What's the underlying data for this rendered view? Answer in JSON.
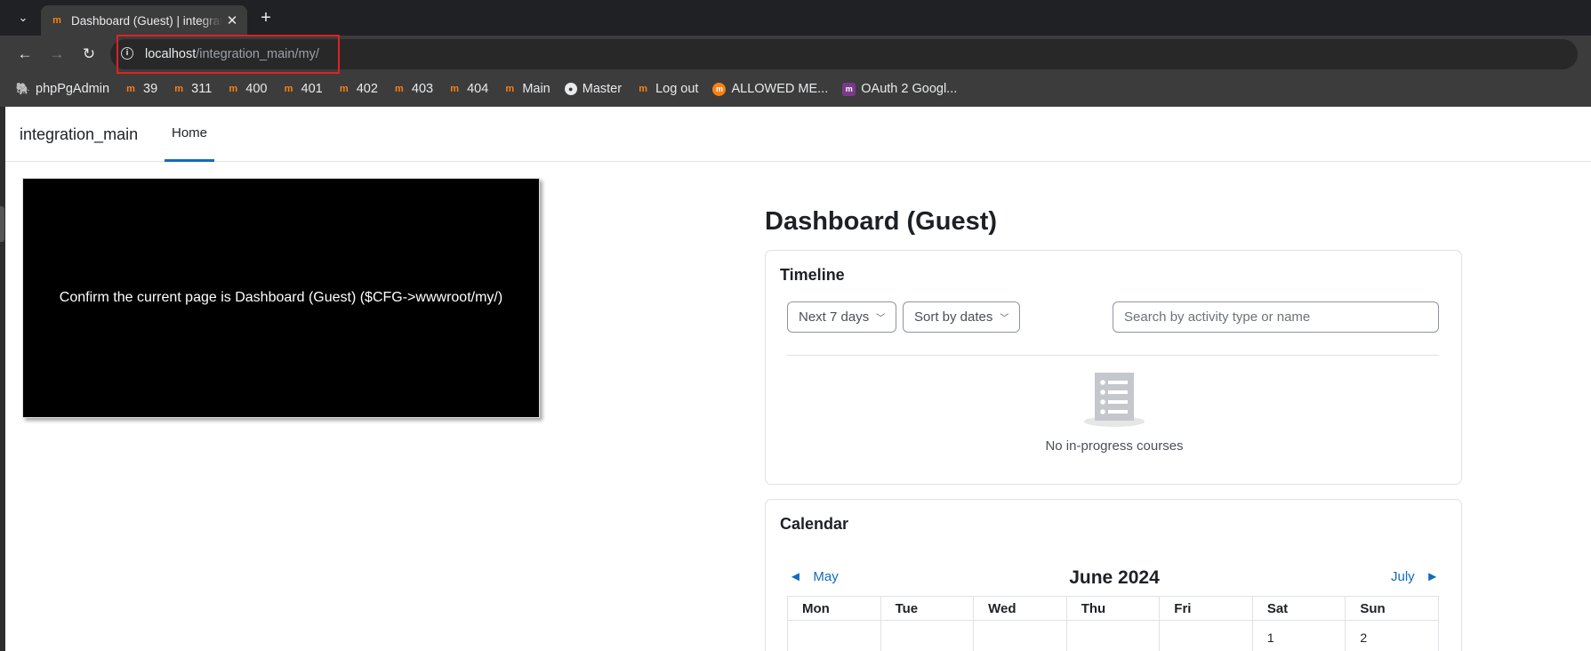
{
  "browser": {
    "tab_title": "Dashboard (Guest) | integration_main",
    "url_host": "localhost",
    "url_path": "/integration_main/my/",
    "bookmarks": [
      {
        "label": "phpPgAdmin",
        "icon": "elephant-icon"
      },
      {
        "label": "39",
        "icon": "moodle-icon"
      },
      {
        "label": "311",
        "icon": "moodle-icon"
      },
      {
        "label": "400",
        "icon": "moodle-icon"
      },
      {
        "label": "401",
        "icon": "moodle-icon"
      },
      {
        "label": "402",
        "icon": "moodle-icon"
      },
      {
        "label": "403",
        "icon": "moodle-icon"
      },
      {
        "label": "404",
        "icon": "moodle-icon"
      },
      {
        "label": "Main",
        "icon": "moodle-icon"
      },
      {
        "label": "Master",
        "icon": "globe-icon"
      },
      {
        "label": "Log out",
        "icon": "moodle-icon"
      },
      {
        "label": "ALLOWED ME...",
        "icon": "moodle-circle-icon"
      },
      {
        "label": "OAuth 2 Googl...",
        "icon": "oauth-icon"
      }
    ]
  },
  "site": {
    "name": "integration_main",
    "nav_home": "Home"
  },
  "overlay_text": "Confirm the current page is Dashboard (Guest) ($CFG->wwwroot/my/)",
  "page_title": "Dashboard (Guest)",
  "timeline": {
    "title": "Timeline",
    "filter_label": "Next 7 days",
    "sort_label": "Sort by dates",
    "search_placeholder": "Search by activity type or name",
    "empty_text": "No in-progress courses"
  },
  "calendar": {
    "title": "Calendar",
    "prev_month": "May",
    "next_month": "July",
    "month_label": "June 2024",
    "weekdays": [
      "Mon",
      "Tue",
      "Wed",
      "Thu",
      "Fri",
      "Sat",
      "Sun"
    ],
    "first_row": [
      "",
      "",
      "",
      "",
      "",
      "1",
      "2"
    ]
  },
  "colors": {
    "accent": "#0f6cbf",
    "highlight_border": "#dd2222",
    "moodle_orange": "#f98012"
  }
}
